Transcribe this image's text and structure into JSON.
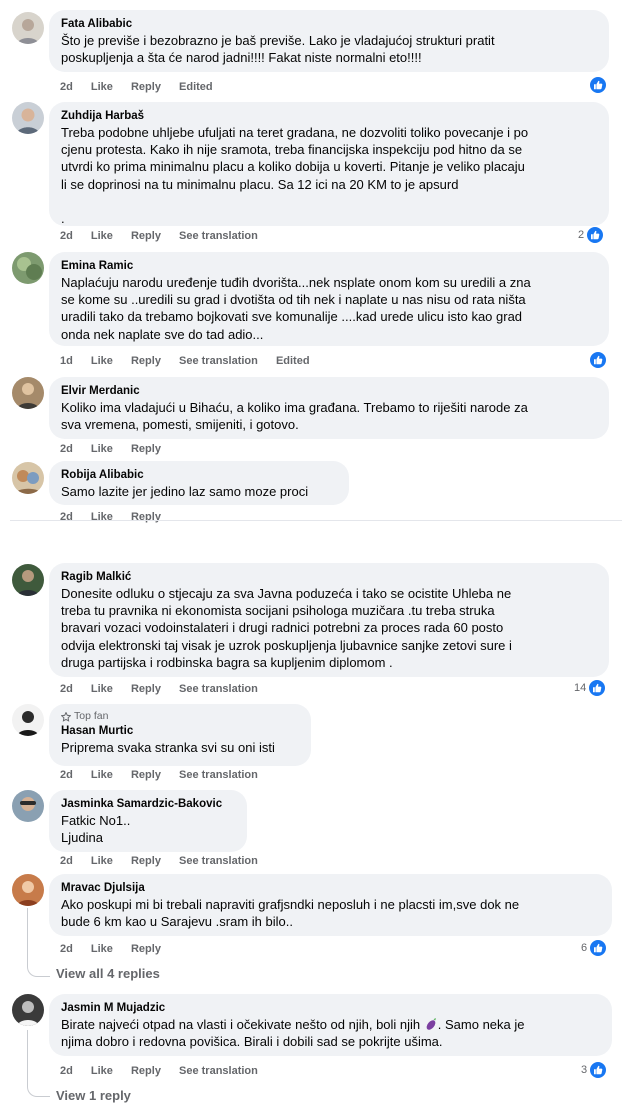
{
  "labels": {
    "like": "Like",
    "reply": "Reply",
    "see_translation": "See translation",
    "edited": "Edited"
  },
  "comments": [
    {
      "name": "Fata Alibabic",
      "text": "Što je previše i bezobrazno je baš previše. Lako je vladajućoj strukturi pratit\nposkupljenja a šta će narod jadni!!!! Fakat niste normalni eto!!!!",
      "time": "2d"
    },
    {
      "name": "Zuhdija Harbaš",
      "text": "Treba podobne uhljebe ufuljati na teret gradana, ne dozvoliti toliko povecanje i po\ncjenu protesta. Kako ih nije sramota, treba financijska inspekciju pod hitno da se\nutvrdi ko prima minimalnu placu a koliko dobija u koverti. Pitanje je veliko placaju\nli se doprinosi na tu minimalnu placu. Sa 12 ici na 20 KM to je apsurd\n\n.",
      "time": "2d",
      "reactions": "2"
    },
    {
      "name": "Emina Ramic",
      "text": "Naplaćuju narodu uređenje tuđih dvorišta...nek nsplate onom kom su uredili a zna\nse kome su ..uredili su grad i dvotišta od tih nek i naplate u nas nisu od rata ništa\nuradili tako da trebamo bojkovati sve komunalije ....kad urede ulicu isto kao grad\nonda nek naplate sve do tad adio...",
      "time": "1d"
    },
    {
      "name": "Elvir Merdanic",
      "text": "Koliko ima vladajući u Bihaću, a koliko ima građana. Trebamo to riješiti narode za\nsva vremena, pomesti, smijeniti, i gotovo.",
      "time": "2d"
    },
    {
      "name": "Robija Alibabic",
      "text": "Samo lazite jer jedino laz samo moze proci",
      "time": "2d"
    },
    {
      "name": "Ragib Malkić",
      "text": "Donesite odluku o stjecaju za sva Javna poduzeća i tako se ocistite Uhleba ne\ntreba tu pravnika ni ekonomista socijani psihologa muzičara .tu treba struka\nbravari vozaci vodoinstalateri i drugi radnici potrebni za proces rada 60 posto\nodvija elektronski taj visak je uzrok poskupljenja ljubavnice sanjke zetovi sure i\ndruga partijska i rodbinska bagra sa kupljenim diplomom .",
      "time": "2d",
      "reactions": "14"
    },
    {
      "name": "Hasan Murtic",
      "badge": "Top fan",
      "text": "Priprema svaka stranka svi su oni isti",
      "time": "2d"
    },
    {
      "name": "Jasminka Samardzic-Bakovic",
      "text": "Fatkic No1..\nLjudina",
      "time": "2d"
    },
    {
      "name": "Mravac Djulsija",
      "text": "Ako poskupi mi bi trebali napraviti grafjsndki neposluh i ne placsti im,sve dok ne\nbude 6 km kao u Sarajevu .sram ih bilo..",
      "time": "2d",
      "reactions": "6",
      "replies": "View all 4 replies"
    },
    {
      "name": "Jasmin M Mujadzic",
      "text_a": "Birate najveći otpad na vlasti i očekivate nešto od njih, boli njih ",
      "text_b": ". Samo neka je\nnjima dobro i redovna povišica. Birali i dobili sad se pokrijte ušima.",
      "time": "2d",
      "reactions": "3",
      "replies": "View 1 reply"
    }
  ],
  "colors": {
    "accent": "#1877f2",
    "bubble": "#f0f2f5",
    "meta": "#65676b"
  },
  "icons": [
    "like-icon",
    "star-icon",
    "eggplant-icon"
  ]
}
